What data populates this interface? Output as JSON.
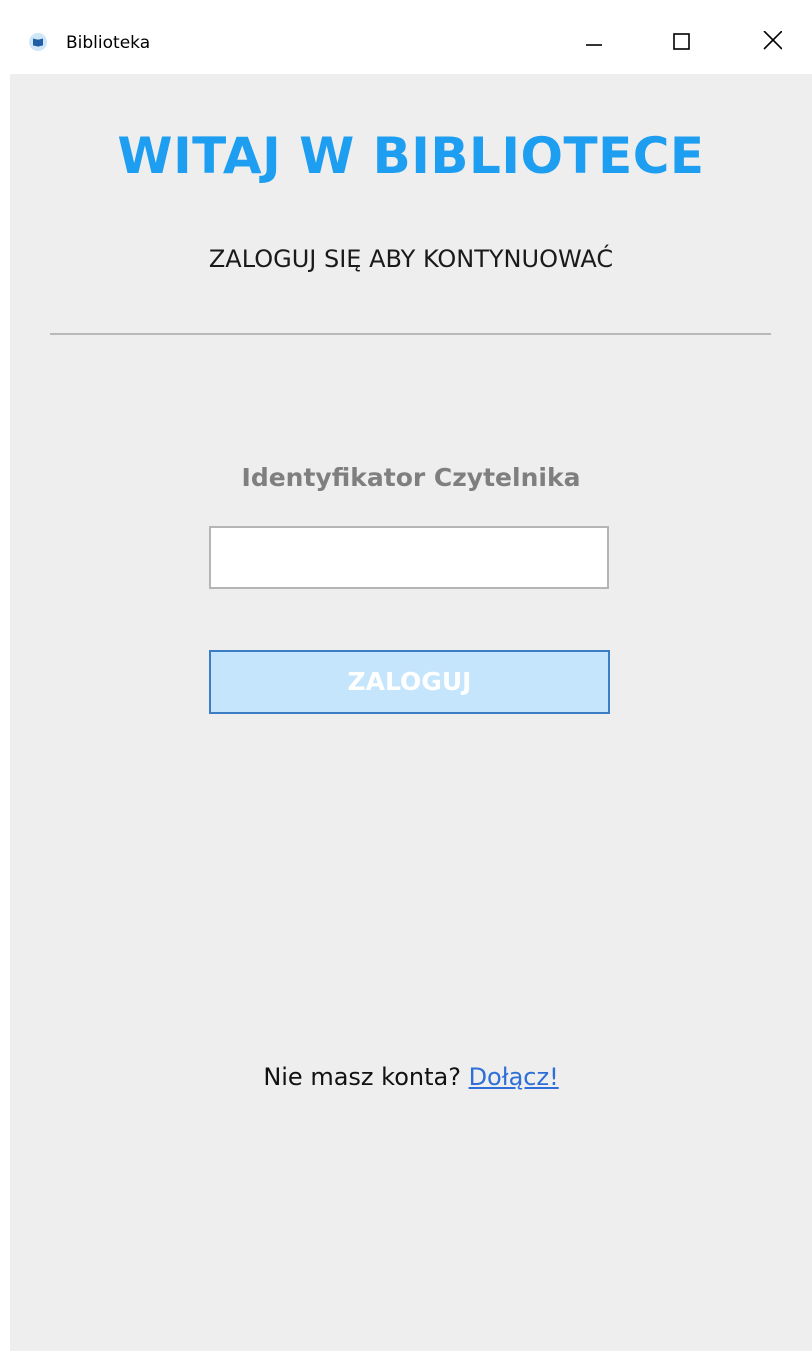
{
  "window": {
    "title": "Biblioteka",
    "icon": "book-icon",
    "controls": {
      "minimize": "minimize-icon",
      "maximize": "maximize-icon",
      "close": "close-icon"
    }
  },
  "main": {
    "heading": "WITAJ W BIBLIOTECE",
    "subheading": "ZALOGUJ SIĘ ABY KONTYNUOWAĆ",
    "id_label": "Identyfikator Czytelnika",
    "id_input": {
      "value": "",
      "placeholder": ""
    },
    "login_button": "ZALOGUJ",
    "footer": {
      "text": "Nie masz konta?",
      "link": "Dołącz!"
    }
  },
  "colors": {
    "accent": "#1e9ef0",
    "background": "#eeeeee",
    "button_fill": "#c4e5fb",
    "button_border": "#3b7ec4",
    "link": "#2e6ed8",
    "label_gray": "#7f7f7f"
  }
}
